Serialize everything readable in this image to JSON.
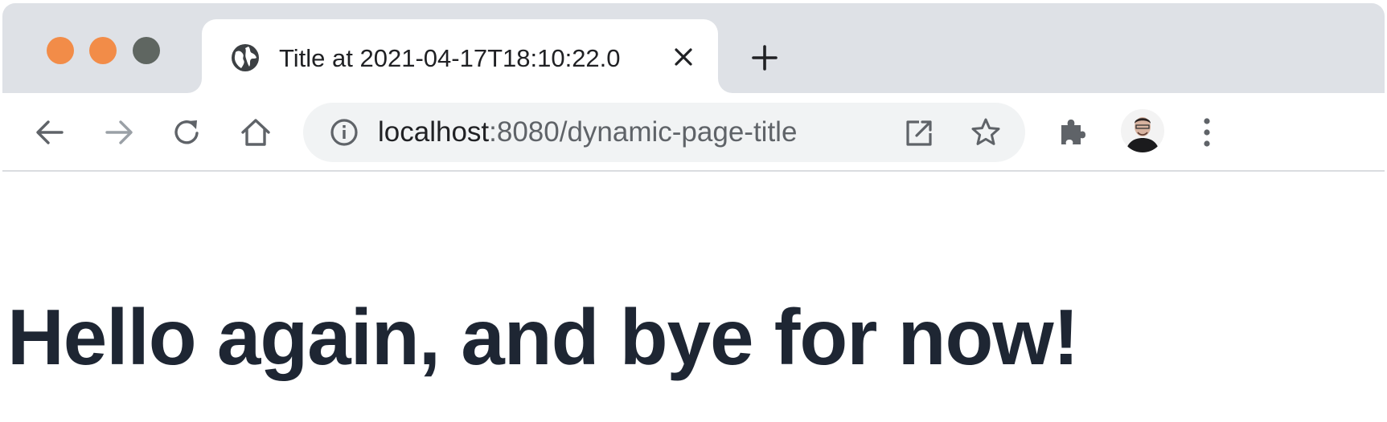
{
  "window": {
    "traffic_lights": {
      "close_color": "#f28c48",
      "minimize_color": "#f28c48",
      "maximize_color": "#5f6661"
    }
  },
  "tab": {
    "favicon": "globe-icon",
    "title": "Title at 2021-04-17T18:10:22.0",
    "close_icon": "close-icon"
  },
  "new_tab": {
    "icon": "plus-icon"
  },
  "toolbar": {
    "back_icon": "arrow-left-icon",
    "forward_icon": "arrow-right-icon",
    "reload_icon": "reload-icon",
    "home_icon": "home-icon",
    "extensions_icon": "puzzle-icon",
    "menu_icon": "kebab-menu-icon"
  },
  "omnibox": {
    "security_icon": "info-icon",
    "url_host": "localhost",
    "url_rest": ":8080/dynamic-page-title",
    "open_icon": "open-in-new-icon",
    "bookmark_icon": "star-icon"
  },
  "page": {
    "heading": "Hello again, and bye for now!"
  },
  "colors": {
    "tabstrip_bg": "#dee1e6",
    "omnibox_bg": "#f1f3f4",
    "heading_text": "#1e2633",
    "icon": "#5f6368",
    "disabled_icon": "#9aa0a6"
  }
}
